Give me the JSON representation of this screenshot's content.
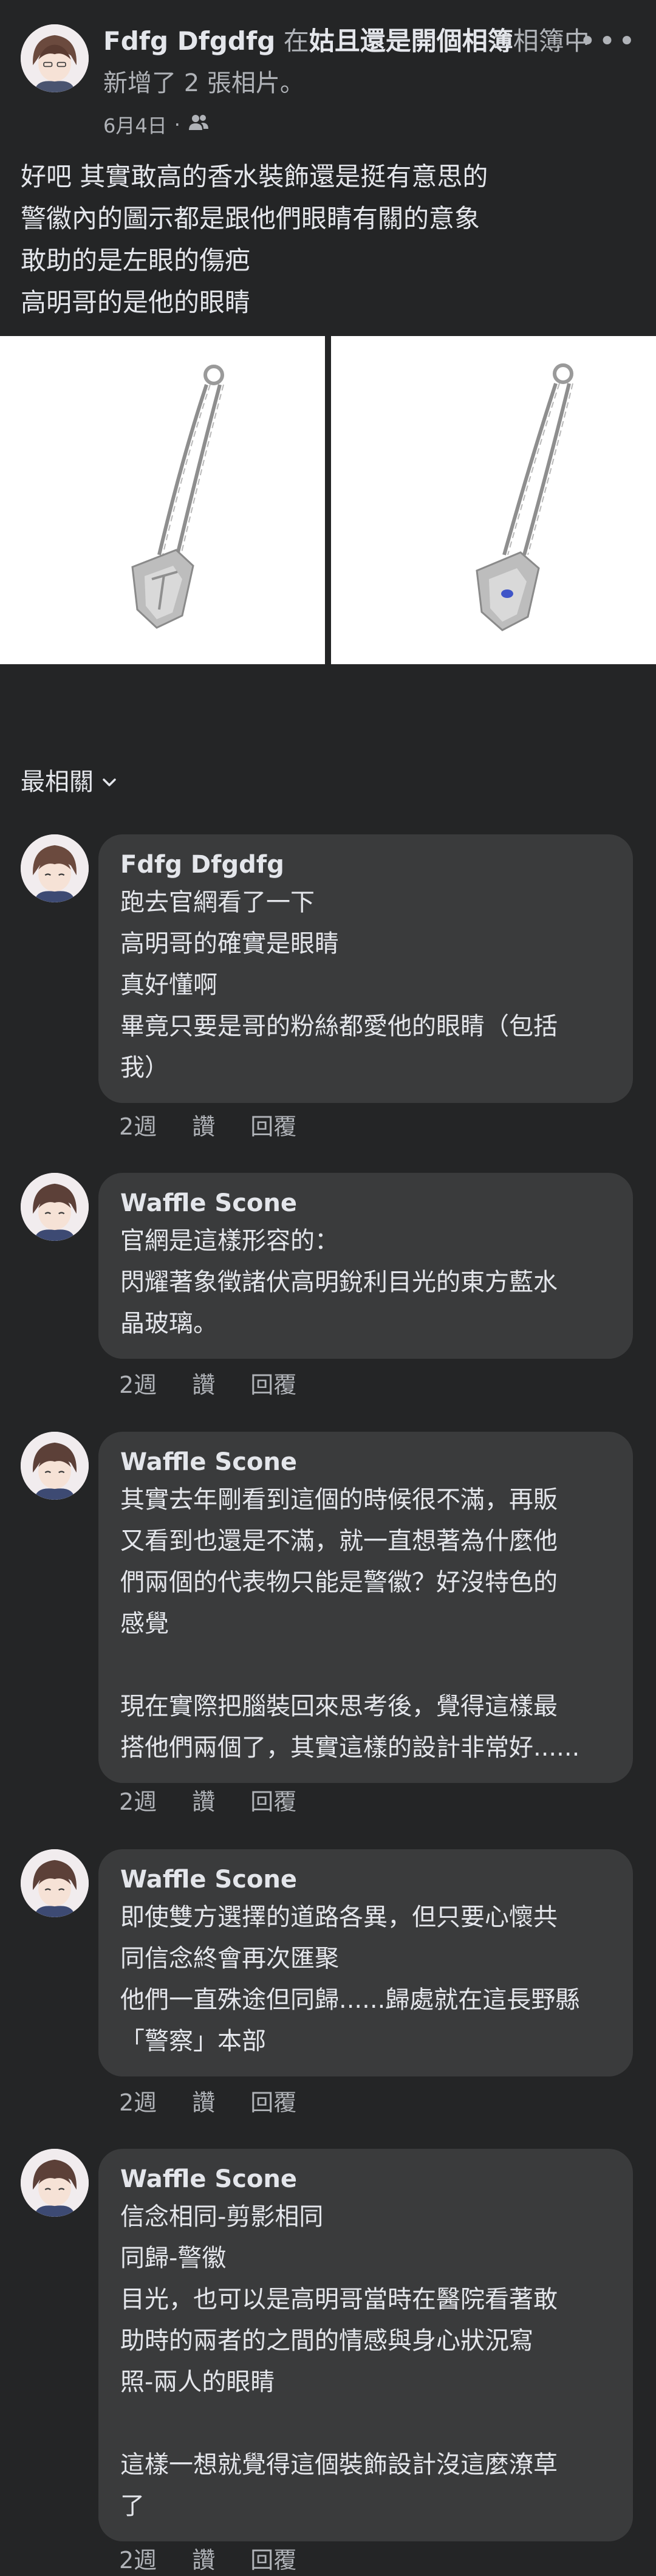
{
  "post": {
    "author": "Fdfg Dfgdfg",
    "in_word": "在",
    "album_name": "姑且還是開個相簿",
    "album_suffix": "相簿中",
    "added": "新增了 2 張相片。",
    "date": "6月4日",
    "date_sep": "·",
    "audience_icon": "friends-icon",
    "text_lines": [
      "好吧 其實敢高的香水裝飾還是挺有意思的",
      "警徽內的圖示都是跟他們眼睛有關的意象",
      "敢助的是左眼的傷疤",
      "高明哥的是他的眼睛"
    ]
  },
  "sort_label": "最相關",
  "comments": [
    {
      "name": "Fdfg Dfgdfg",
      "lines": [
        "跑去官網看了一下",
        "高明哥的確實是眼睛",
        "真好懂啊",
        "畢竟只要是哥的粉絲都愛他的眼睛（包括",
        "我）"
      ],
      "time": "2週",
      "like": "讚",
      "reply": "回覆"
    },
    {
      "name": "Waffle Scone",
      "lines": [
        "官網是這樣形容的：",
        "閃耀著象徵諸伏高明銳利目光的東方藍水",
        "晶玻璃。"
      ],
      "time": "2週",
      "like": "讚",
      "reply": "回覆"
    },
    {
      "name": "Waffle Scone",
      "lines": [
        "其實去年剛看到這個的時候很不滿，再販",
        "又看到也還是不滿，就一直想著為什麼他",
        "們兩個的代表物只能是警徽？好沒特色的",
        "感覺",
        "",
        "現在實際把腦裝回來思考後，覺得這樣最",
        "搭他們兩個了，其實這樣的設計非常好......"
      ],
      "time": "2週",
      "like": "讚",
      "reply": "回覆"
    },
    {
      "name": "Waffle Scone",
      "lines": [
        "即使雙方選擇的道路各異，但只要心懷共",
        "同信念終會再次匯聚",
        "他們一直殊途但同歸......歸處就在這長野縣",
        "「警察」本部"
      ],
      "time": "2週",
      "like": "讚",
      "reply": "回覆"
    },
    {
      "name": "Waffle Scone",
      "lines": [
        "信念相同-剪影相同",
        "同歸-警徽",
        "目光，也可以是高明哥當時在醫院看著敢",
        "助時的兩者的之間的情感與身心狀況寫",
        "照-兩人的眼睛",
        "",
        "這樣一想就覺得這個裝飾設計沒這麼潦草",
        "了"
      ],
      "time": "2週",
      "like": "讚",
      "reply": "回覆"
    }
  ]
}
